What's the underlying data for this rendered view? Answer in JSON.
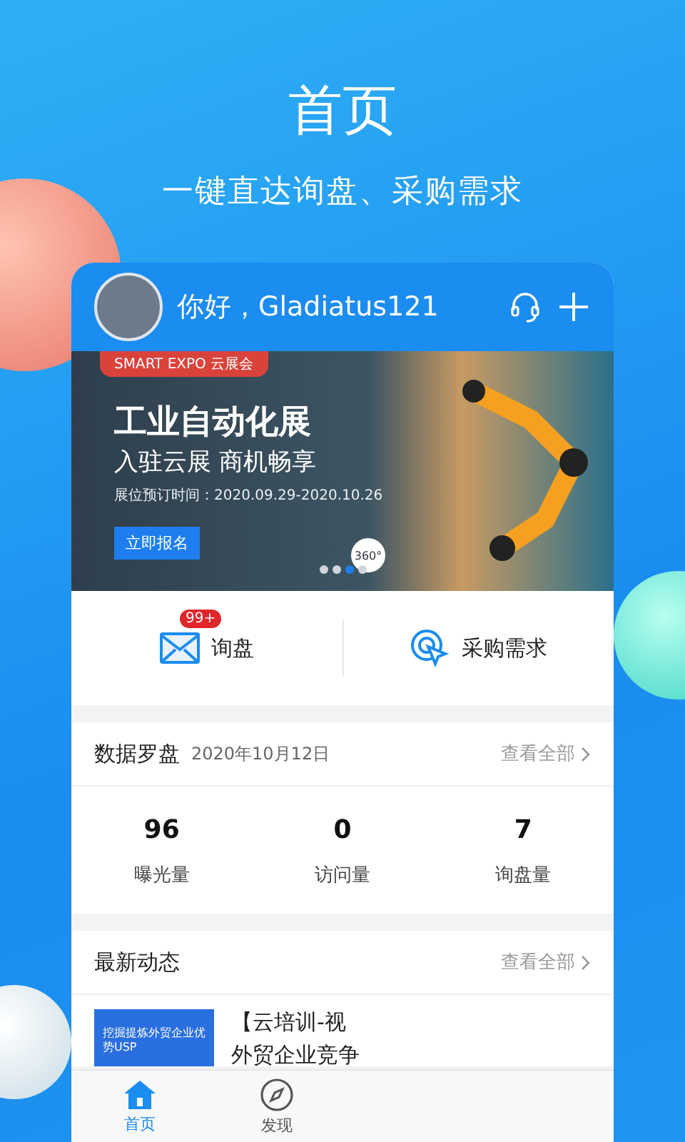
{
  "promo": {
    "title": "首页",
    "subtitle": "一键直达询盘、采购需求"
  },
  "header": {
    "greeting": "你好，Gladiatus121"
  },
  "banner": {
    "tag": "SMART EXPO 云展会",
    "headline": "工业自动化展",
    "tagline": "入驻云展 商机畅享",
    "dates": "展位预订时间：2020.09.29-2020.10.26",
    "button": "立即报名",
    "badge_360": "360°",
    "dots": [
      {
        "selected": false
      },
      {
        "selected": false
      },
      {
        "selected": true
      },
      {
        "selected": false
      }
    ]
  },
  "actions": [
    {
      "kind": "mail",
      "label": "询盘",
      "badge": "99+"
    },
    {
      "kind": "target",
      "label": "采购需求"
    }
  ],
  "compass": {
    "title": "数据罗盘",
    "date": "2020年10月12日",
    "link": "查看全部",
    "stats": [
      {
        "value": "96",
        "label": "曝光量"
      },
      {
        "value": "0",
        "label": "访问量"
      },
      {
        "value": "7",
        "label": "询盘量"
      }
    ]
  },
  "news": {
    "title": "最新动态",
    "link": "查看全部",
    "items": [
      {
        "thumb_text": "挖掘提炼外贸企业优势USP",
        "title_line1": "【云培训-视",
        "title_line2": "外贸企业竞争"
      }
    ]
  },
  "tab_bar": [
    {
      "kind": "home",
      "label": "首页",
      "selected": true
    },
    {
      "kind": "compass",
      "label": "发现",
      "selected": false
    }
  ]
}
